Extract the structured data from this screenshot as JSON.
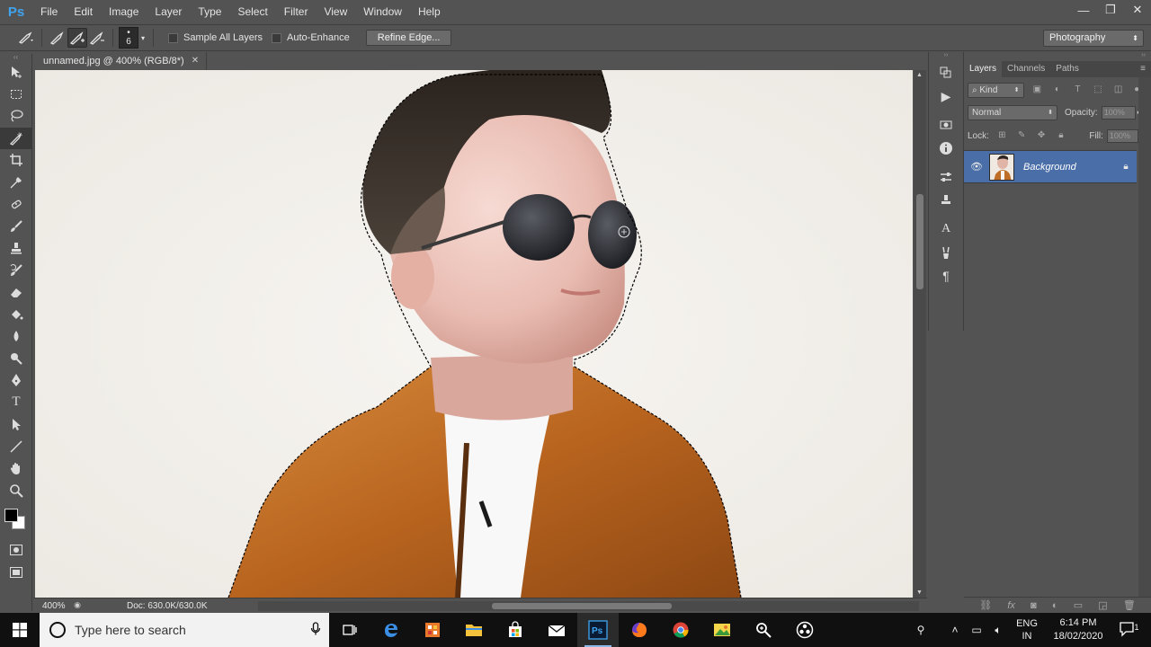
{
  "app": {
    "logo_text": "Ps"
  },
  "menu": [
    "File",
    "Edit",
    "Image",
    "Layer",
    "Type",
    "Select",
    "Filter",
    "View",
    "Window",
    "Help"
  ],
  "window_controls": {
    "minimize": "—",
    "restore": "❐",
    "close": "✕"
  },
  "options_bar": {
    "brush_size": "6",
    "sample_all_layers": "Sample All Layers",
    "auto_enhance": "Auto-Enhance",
    "refine_edge": "Refine Edge...",
    "workspace": "Photography"
  },
  "document": {
    "tab_title": "unnamed.jpg @ 400% (RGB/8*)",
    "zoom": "400%",
    "doc_size": "Doc: 630.0K/630.0K"
  },
  "colors": {
    "foreground": "#000000",
    "background": "#ffffff",
    "selected_layer": "#4a6ea8"
  },
  "tools": [
    "move-tool",
    "marquee-tool",
    "lasso-tool",
    "quick-selection-tool",
    "crop-tool",
    "eyedropper-tool",
    "healing-brush-tool",
    "brush-tool",
    "clone-stamp-tool",
    "history-brush-tool",
    "eraser-tool",
    "paint-bucket-tool",
    "blur-tool",
    "dodge-tool",
    "pen-tool",
    "type-tool",
    "path-selection-tool",
    "line-tool",
    "hand-tool",
    "zoom-tool"
  ],
  "layers_panel": {
    "tabs": [
      "Layers",
      "Channels",
      "Paths"
    ],
    "filter_kind": "Kind",
    "blend_mode": "Normal",
    "opacity_label": "Opacity:",
    "opacity_value": "100%",
    "lock_label": "Lock:",
    "fill_label": "Fill:",
    "fill_value": "100%",
    "layer_name": "Background"
  },
  "taskbar": {
    "search_placeholder": "Type here to search",
    "lang_line1": "ENG",
    "lang_line2": "IN",
    "time": "6:14 PM",
    "date": "18/02/2020",
    "notification_count": "1"
  }
}
